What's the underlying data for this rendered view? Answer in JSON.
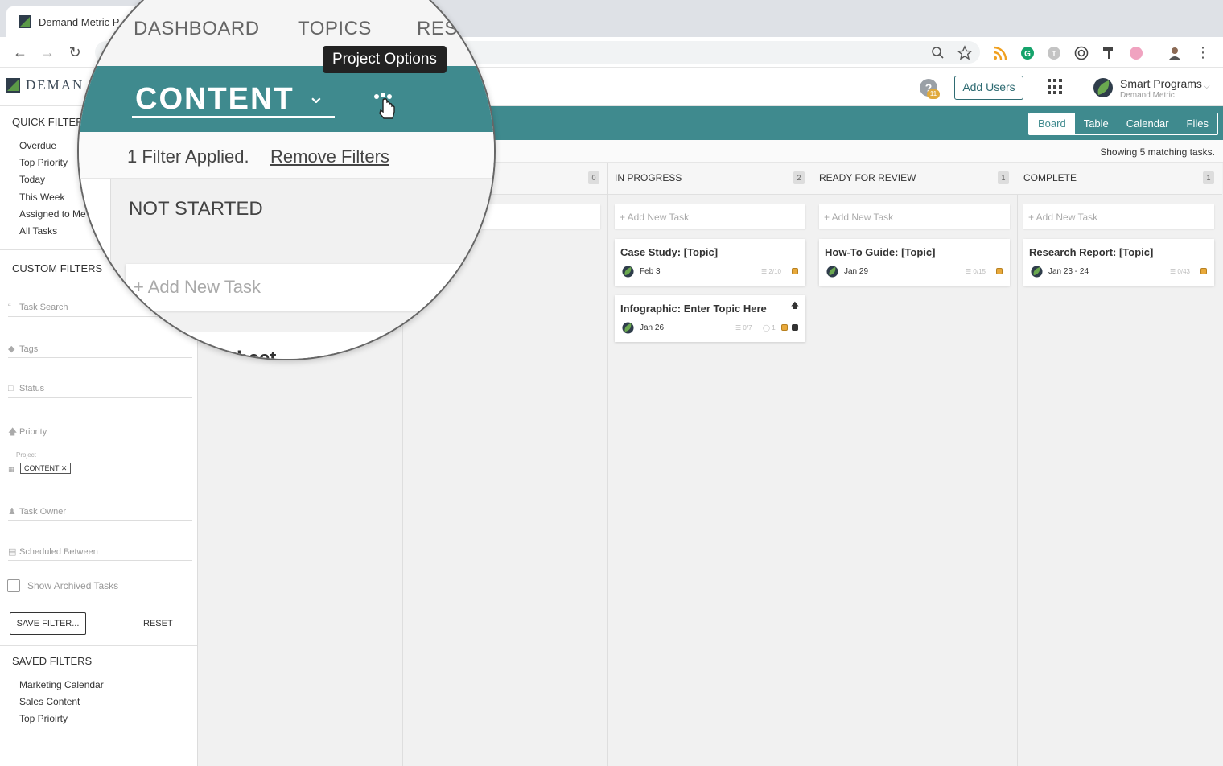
{
  "browser": {
    "tab_title": "Demand Metric P"
  },
  "header": {
    "brand": "DEMAN",
    "help_badge": "11",
    "add_users": "Add Users",
    "account_name": "Smart Programs",
    "account_org": "Demand Metric"
  },
  "view_tabs": [
    "Board",
    "Table",
    "Calendar",
    "Files"
  ],
  "showing": "Showing 5 matching tasks.",
  "sidebar": {
    "quick_filters_title": "QUICK FILTERS",
    "quick_filters": [
      "Overdue",
      "Top Priority",
      "Today",
      "This Week",
      "Assigned to Me",
      "All Tasks"
    ],
    "custom_filters_title": "CUSTOM FILTERS",
    "task_search": "Task Search",
    "tags": "Tags",
    "status": "Status",
    "priority": "Priority",
    "project_label": "Project",
    "project_chip": "CONTENT",
    "task_owner": "Task Owner",
    "scheduled": "Scheduled Between",
    "show_archived": "Show Archived Tasks",
    "save_filter": "SAVE FILTER...",
    "reset": "RESET",
    "saved_filters_title": "SAVED FILTERS",
    "saved_filters": [
      "Marketing Calendar",
      "Sales Content",
      "Top Prioirty"
    ]
  },
  "columns": [
    {
      "title": "",
      "count": "0"
    },
    {
      "title": "IN PROGRESS",
      "count": "2"
    },
    {
      "title": "READY FOR REVIEW",
      "count": "1"
    },
    {
      "title": "COMPLETE",
      "count": "1"
    }
  ],
  "add_task": "+ Add New Task",
  "cards": {
    "in_progress": [
      {
        "title": "Case Study: [Topic]",
        "date": "Feb 3",
        "checklist": "2/10"
      },
      {
        "title": "Infographic: Enter Topic Here",
        "date": "Jan 26",
        "checklist": "0/7",
        "comments": "1"
      }
    ],
    "review": [
      {
        "title": "How-To Guide: [Topic]",
        "date": "Jan 29",
        "checklist": "0/15"
      }
    ],
    "complete": [
      {
        "title": "Research Report: [Topic]",
        "date": "Jan 23 - 24",
        "checklist": "0/43"
      }
    ]
  },
  "magnifier": {
    "nav": [
      "DASHBOARD",
      "TOPICS",
      "RES"
    ],
    "tooltip": "Project Options",
    "project": "CONTENT",
    "filter_applied": "1 Filter Applied.",
    "remove_filters": "Remove Filters",
    "column": "NOT STARTED",
    "add_task": "+ Add New Task",
    "peek_text": "t sheet"
  },
  "colors": {
    "teal": "#3f8a8e",
    "gold": "#e8a93b"
  }
}
